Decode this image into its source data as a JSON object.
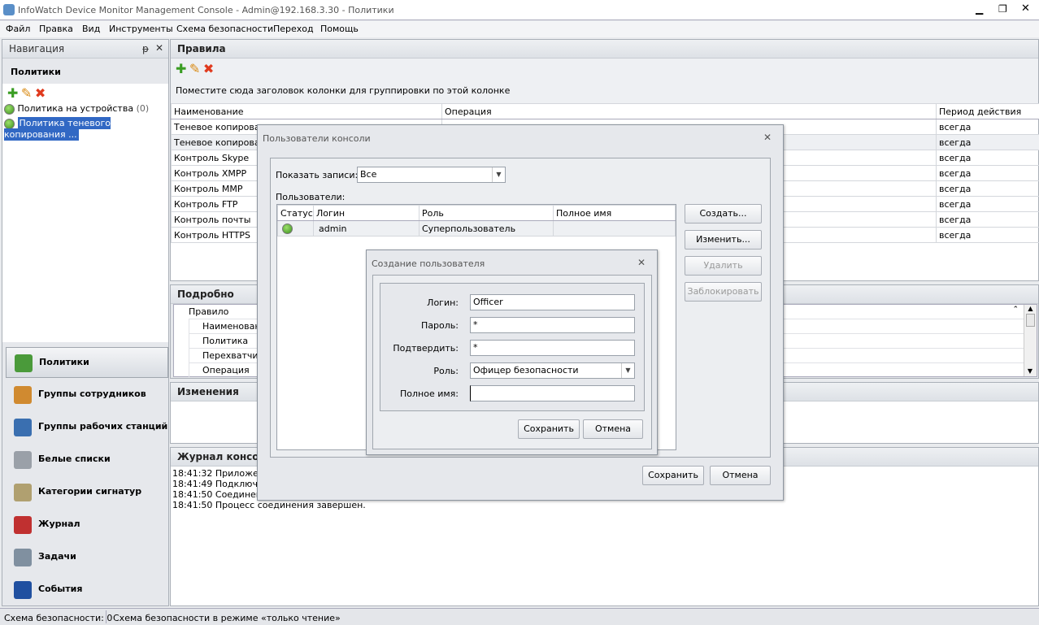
{
  "window": {
    "title": "InfoWatch Device Monitor Management Console - Admin@192.168.3.30 - Политики",
    "controls": [
      "minimize",
      "maximize",
      "close"
    ]
  },
  "menu": [
    "Файл",
    "Правка",
    "Вид",
    "Инструменты",
    "Схема безопасности",
    "Переход",
    "Помощь"
  ],
  "nav": {
    "title": "Навигация",
    "section": "Политики",
    "tree": [
      {
        "label": "Политика на устройства",
        "count": "(0)"
      },
      {
        "label": "Политика теневого копирования ..."
      }
    ],
    "buttons": [
      {
        "label": "Политики",
        "icon": "policies-icon",
        "color": "#4a9a3a"
      },
      {
        "label": "Группы сотрудников",
        "icon": "users-group-icon",
        "color": "#d08a30"
      },
      {
        "label": "Группы рабочих станций",
        "icon": "workstations-icon",
        "color": "#3a6fb0"
      },
      {
        "label": "Белые списки",
        "icon": "whitelist-icon",
        "color": "#9aa0a8"
      },
      {
        "label": "Категории сигнатур",
        "icon": "signatures-icon",
        "color": "#b0a070"
      },
      {
        "label": "Журнал",
        "icon": "journal-icon",
        "color": "#c03030"
      },
      {
        "label": "Задачи",
        "icon": "tasks-icon",
        "color": "#8090a0"
      },
      {
        "label": "События",
        "icon": "events-icon",
        "color": "#2050a0"
      }
    ]
  },
  "rules": {
    "title": "Правила",
    "group_hint": "Поместите сюда заголовок колонки для группировки по этой колонке",
    "columns": [
      "Наименование",
      "Операция",
      "Период действия"
    ],
    "rows": [
      [
        "Теневое копирование",
        "",
        "всегда"
      ],
      [
        "Теневое копирование",
        "",
        "всегда"
      ],
      [
        "Контроль Skype",
        "",
        "всегда"
      ],
      [
        "Контроль XMPP",
        "",
        "всегда"
      ],
      [
        "Контроль MMP",
        "",
        "всегда"
      ],
      [
        "Контроль FTP",
        "",
        "всегда"
      ],
      [
        "Контроль почты",
        "",
        "всегда"
      ],
      [
        "Контроль HTTPS",
        "",
        "всегда"
      ]
    ]
  },
  "details": {
    "title": "Подробно",
    "group": "Правило",
    "fields": [
      "Наименование",
      "Политика",
      "Перехватчик",
      "Операция"
    ]
  },
  "changes": {
    "title": "Изменения"
  },
  "log": {
    "title": "Журнал консоли",
    "lines": [
      "18:41:32 Приложение",
      "18:41:49 Подключение",
      "18:41:50 Соединение",
      "18:41:50 Процесс соединения завершен."
    ]
  },
  "console_users": {
    "title": "Пользователи консоли",
    "show_label": "Показать записи:",
    "show_value": "Все",
    "users_label": "Пользователи:",
    "columns": [
      "Статус",
      "Логин",
      "Роль",
      "Полное имя"
    ],
    "rows": [
      {
        "login": "admin",
        "role": "Суперпользователь",
        "full_name": ""
      }
    ],
    "buttons": {
      "create": "Создать...",
      "edit": "Изменить...",
      "delete": "Удалить",
      "block": "Заблокировать",
      "save": "Сохранить",
      "cancel": "Отмена"
    }
  },
  "create_user": {
    "title": "Создание пользователя",
    "login_label": "Логин:",
    "login": "Officer",
    "password_label": "Пароль:",
    "password": "*",
    "confirm_label": "Подтвердить:",
    "confirm": "*",
    "role_label": "Роль:",
    "role": "Офицер безопасности",
    "fullname_label": "Полное имя:",
    "fullname": "",
    "save": "Сохранить",
    "cancel": "Отмена"
  },
  "status": [
    "Схема безопасности: 0",
    "Схема безопасности в режиме «только чтение»"
  ]
}
